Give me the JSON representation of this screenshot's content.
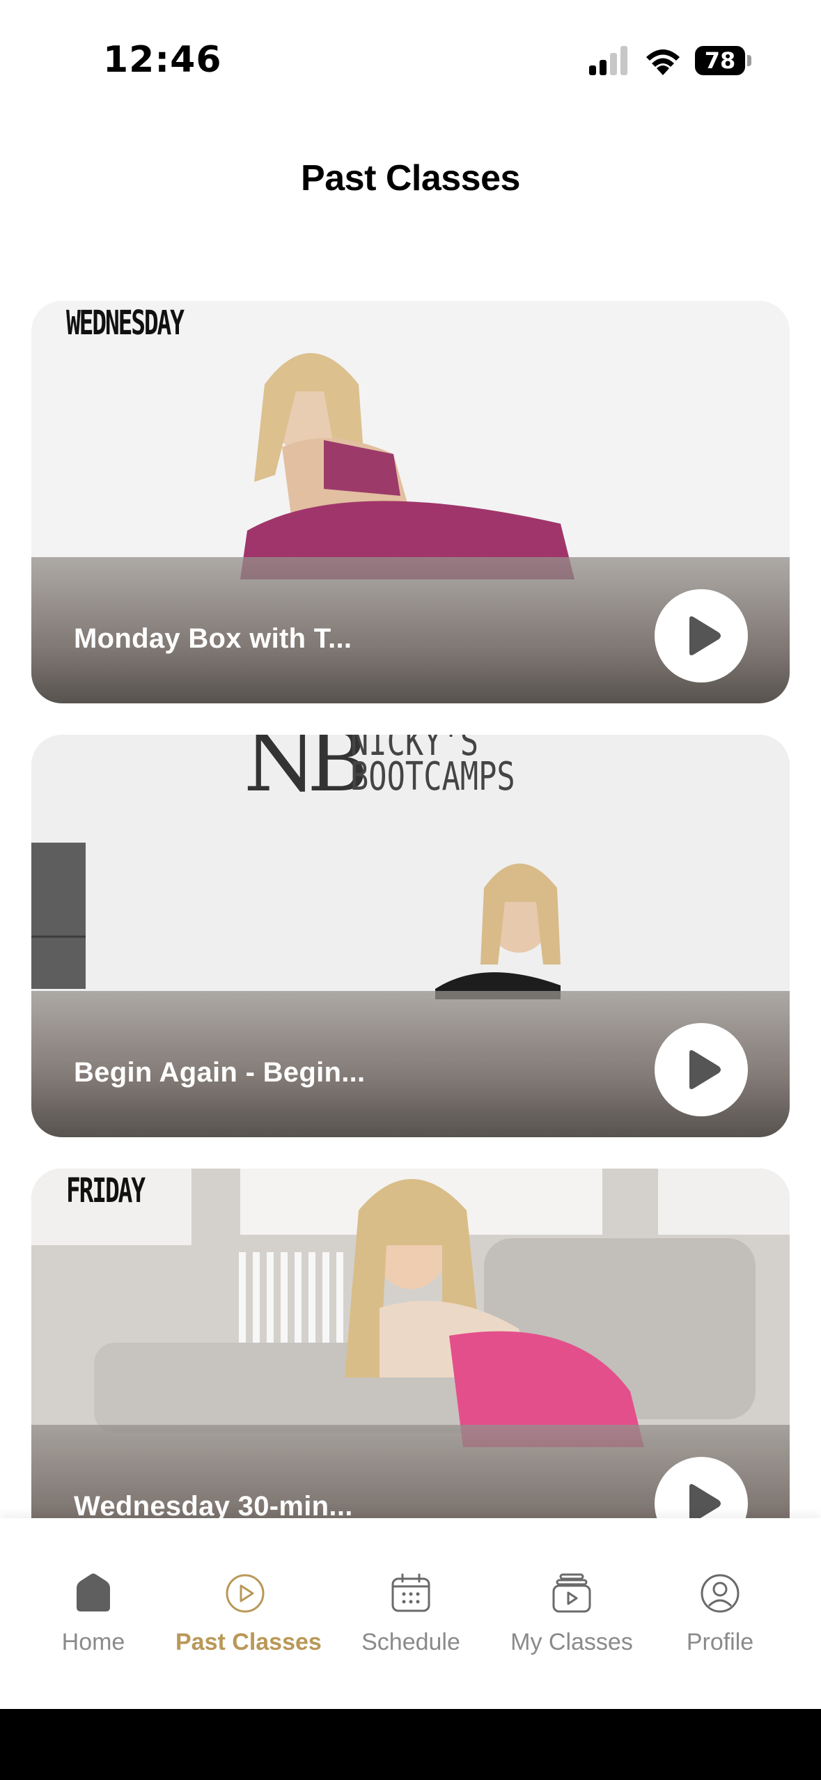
{
  "status_bar": {
    "time": "12:46",
    "battery": "78"
  },
  "header": {
    "title": "Past Classes"
  },
  "classes": [
    {
      "title": "Monday Box with T...",
      "day_label": "WEDNESDAY"
    },
    {
      "title": "Begin Again - Begin...",
      "brand_mark": "NB",
      "brand_line1": "NICKY'S",
      "brand_line2": "BOOTCAMPS"
    },
    {
      "title": "Wednesday 30-min...",
      "day_label": "FRIDAY"
    }
  ],
  "tab_bar": {
    "tabs": [
      {
        "label": "Home",
        "icon": "home-icon",
        "active": false
      },
      {
        "label": "Past Classes",
        "icon": "play-circle-icon",
        "active": true
      },
      {
        "label": "Schedule",
        "icon": "calendar-icon",
        "active": false
      },
      {
        "label": "My Classes",
        "icon": "video-library-icon",
        "active": false
      },
      {
        "label": "Profile",
        "icon": "user-icon",
        "active": false
      }
    ]
  },
  "colors": {
    "accent": "#b99858",
    "inactive": "#8a8a8a"
  }
}
